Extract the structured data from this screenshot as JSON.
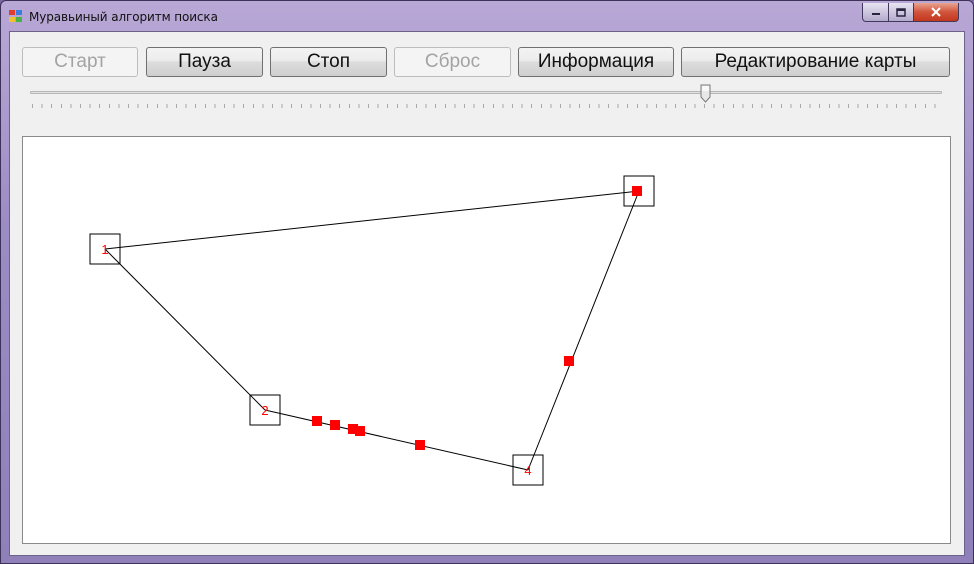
{
  "window": {
    "title": "Муравьиный алгоритм поиска"
  },
  "toolbar": {
    "start_label": "Старт",
    "pause_label": "Пауза",
    "stop_label": "Стоп",
    "reset_label": "Сброс",
    "info_label": "Информация",
    "edit_map_label": "Редактирование карты"
  },
  "speed_slider": {
    "value_fraction": 0.75
  },
  "map": {
    "nodes": [
      {
        "label": "1"
      },
      {
        "label": "2"
      },
      {
        "label": ""
      },
      {
        "label": "4"
      }
    ],
    "edge_color": "#000000",
    "label_color": "#ff0000",
    "ant_color": "#ff0000"
  },
  "colors": {
    "close_button": "#c3361e",
    "title_bar": "#9c8cc4"
  }
}
